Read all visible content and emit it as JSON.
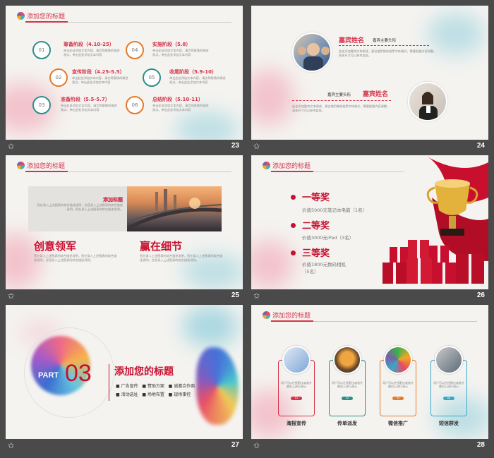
{
  "common": {
    "section_title": "添加您的标题",
    "star_glyph": "✩"
  },
  "slide23": {
    "number": "23",
    "items": [
      {
        "num": "01",
        "head": "筹备阶段（4.10-25）",
        "color": "#2b8f8a"
      },
      {
        "num": "04",
        "head": "实施阶段（5.8）",
        "color": "#e37b2a"
      },
      {
        "num": "02",
        "head": "宣传阶段（4.25-5.5）",
        "color": "#e37b2a"
      },
      {
        "num": "05",
        "head": "收尾阶段（5.9-10）",
        "color": "#2b8f8a"
      },
      {
        "num": "03",
        "head": "准备阶段（5.5-5.7）",
        "color": "#2b8f8a"
      },
      {
        "num": "06",
        "head": "总结阶段（5.10-11）",
        "color": "#e37b2a"
      }
    ],
    "desc": "单击此处添加文本内容，请言简意赅的阐述观点。单击此处添加文本内容"
  },
  "slide24": {
    "number": "24",
    "guest_name": "嘉宾姓名",
    "guest_sub": "嘉宾主要头衔",
    "guest_desc": "此处添加嘉宾文本阐述，建议使用微软雅黑字体格式，需要根据内容调整，具体尺寸可以参考此处。"
  },
  "slide25": {
    "number": "25",
    "box_title": "添加标题",
    "box_text": "您在录入上述图表的综合描述说明，在您录入上述图表的综合描述说明，您在录入上述图表的综合描述说明。",
    "left_head": "创意领军",
    "right_head": "赢在细节",
    "col_text": "您在录入上述图表的综合描述说明，您在录入上述图表的综合描述说明，在您录入上述图表的综合描述说明。"
  },
  "slide26": {
    "number": "26",
    "prizes": [
      {
        "name": "一等奖",
        "desc": "价值5000元笔记本电脑（1名）"
      },
      {
        "name": "二等奖",
        "desc": "价值3000元iPad（3名）"
      },
      {
        "name": "三等奖",
        "desc_line1": "价值1800元数码相机",
        "desc_line2": "（5名）"
      }
    ]
  },
  "slide27": {
    "number": "27",
    "part_word": "PART",
    "part_num": "03",
    "heading": "添加您的标题",
    "bullets": [
      "广告宣传",
      "赞助方案",
      "诚邀合作商",
      "活动选址",
      "场地布置",
      "现场事控"
    ]
  },
  "slide28": {
    "number": "28",
    "card_text": "用户可以在投影仪或者计算机上进行演示",
    "cards": [
      {
        "label": "海报宣传",
        "pill": "01",
        "color": "#d6334a"
      },
      {
        "label": "传单派发",
        "pill": "02",
        "color": "#2b8f8a"
      },
      {
        "label": "微信推广",
        "pill": "03",
        "color": "#e37b2a"
      },
      {
        "label": "短信群发",
        "pill": "04",
        "color": "#3aa7c7"
      }
    ]
  }
}
